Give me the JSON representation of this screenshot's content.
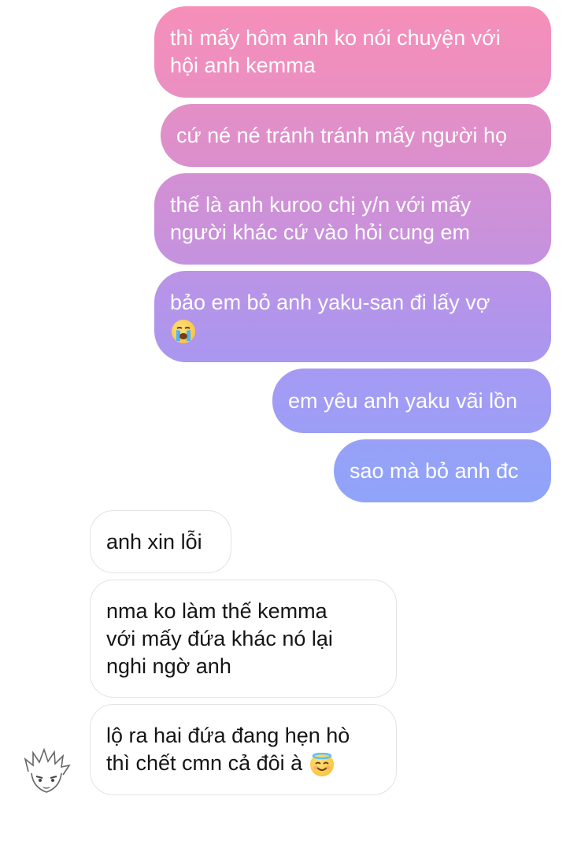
{
  "conversation": {
    "messages": [
      {
        "sender": "me",
        "text": "thì mấy hôm anh ko nói chuyện với\nhội anh kemma"
      },
      {
        "sender": "me",
        "text": "cứ né né tránh tránh mấy người họ"
      },
      {
        "sender": "me",
        "text": "thế là anh kuroo chị y/n với mấy\nngười khác cứ vào hỏi cung em"
      },
      {
        "sender": "me",
        "text": "bảo em bỏ anh yaku-san đi lấy vợ\n",
        "emoji": "crying-face-emoji"
      },
      {
        "sender": "me",
        "text": "em yêu anh yaku vãi lồn"
      },
      {
        "sender": "me",
        "text": "sao mà bỏ anh đc"
      },
      {
        "sender": "them",
        "text": "anh xin lỗi"
      },
      {
        "sender": "them",
        "text": "nma ko làm thế kemma\nvới mấy đứa khác nó lại\nnghi ngờ anh"
      },
      {
        "sender": "them",
        "text": "lộ ra hai đứa đang hẹn hò\nthì chết cmn cả đôi à ",
        "emoji": "smiling-face-with-halo-emoji"
      }
    ]
  },
  "colors": {
    "gradient_top": "#f48fb8",
    "gradient_mid": "#c990dc",
    "gradient_bottom": "#8fa2f8",
    "incoming_bg": "#ffffff",
    "incoming_border": "#e3e3e3",
    "incoming_text": "#151515",
    "outgoing_text": "#ffffff"
  }
}
